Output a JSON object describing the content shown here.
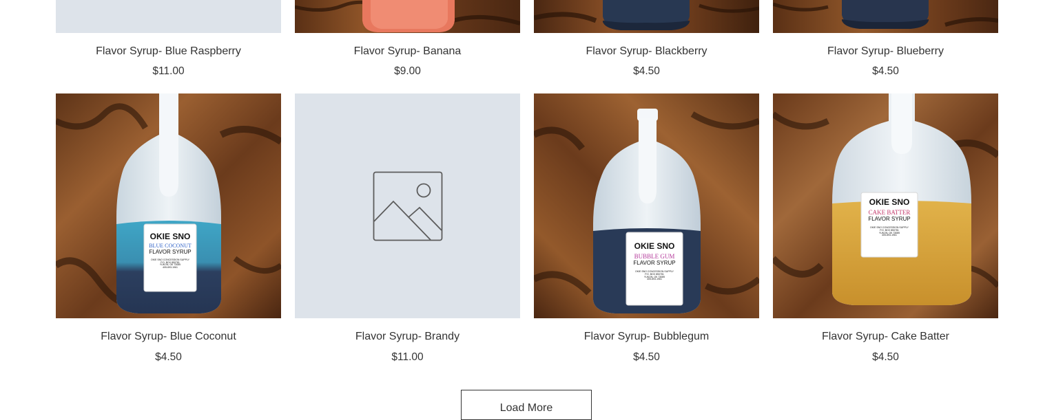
{
  "products_row1": [
    {
      "name": "Flavor Syrup- Blue Raspberry",
      "price": "$11.00",
      "image": "placeholder"
    },
    {
      "name": "Flavor Syrup- Banana",
      "price": "$9.00",
      "image": "jug-red"
    },
    {
      "name": "Flavor Syrup- Blackberry",
      "price": "$4.50",
      "image": "jug-navy"
    },
    {
      "name": "Flavor Syrup- Blueberry",
      "price": "$4.50",
      "image": "jug-navy"
    }
  ],
  "products_row2": [
    {
      "name": "Flavor Syrup- Blue Coconut",
      "price": "$4.50",
      "image": "jug-blue-coconut",
      "label": {
        "brand": "OKIE SNO",
        "flavor": "BLUE COCONUT",
        "type": "FLAVOR SYRUP",
        "l1": "OKIE SNO CONCESSION SUPPLY",
        "l2": "P.O. BOX 850781",
        "l3": "YUKON, OK 73085",
        "l4": "405-693-1961"
      }
    },
    {
      "name": "Flavor Syrup- Brandy",
      "price": "$11.00",
      "image": "placeholder"
    },
    {
      "name": "Flavor Syrup- Bubblegum",
      "price": "$4.50",
      "image": "jug-bubblegum",
      "label": {
        "brand": "OKIE SNO",
        "flavor": "BUBBLE GUM",
        "type": "FLAVOR SYRUP",
        "l1": "OKIE SNO CONCESSION SUPPLY",
        "l2": "P.O. BOX 850781",
        "l3": "YUKON, OK 73085",
        "l4": "405-693-1961"
      }
    },
    {
      "name": "Flavor Syrup- Cake Batter",
      "price": "$4.50",
      "image": "jug-cake-batter",
      "label": {
        "brand": "OKIE SNO",
        "flavor": "CAKE BATTER",
        "type": "FLAVOR SYRUP",
        "l1": "OKIE SNO CONCESSION SUPPLY",
        "l2": "P.O. BOX 850781",
        "l3": "YUKON, OK 73085",
        "l4": "405-693-1961"
      }
    }
  ],
  "load_more_label": "Load More",
  "colors": {
    "placeholder_bg": "#dde3ea",
    "placeholder_icon": "#5c5c5c",
    "text": "#333333",
    "blue_syrup": "#3c9fc0",
    "navy_syrup": "#283852",
    "amber_syrup": "#d9a83a",
    "flavor_blue": "#2f62c7",
    "flavor_pink": "#b3389a",
    "flavor_cake": "#c43a6c"
  }
}
